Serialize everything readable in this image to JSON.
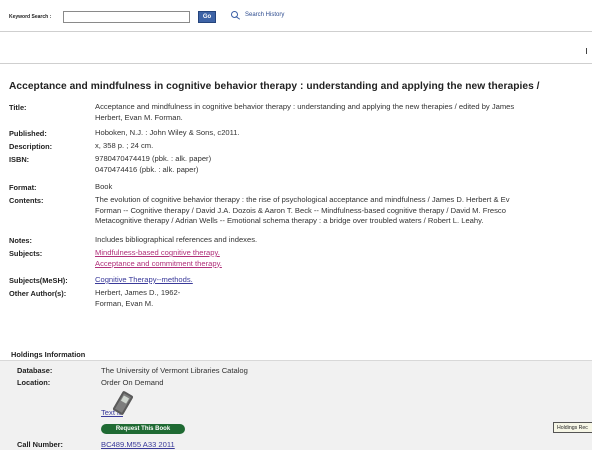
{
  "search": {
    "label": "Keyword Search :",
    "value": "",
    "go_label": "Go",
    "history_label": "Search History"
  },
  "record": {
    "title": "Acceptance and mindfulness in cognitive behavior therapy : understanding and applying the new therapies /",
    "fields": [
      {
        "label": "Title:",
        "lines": [
          "Acceptance and mindfulness in cognitive behavior therapy : understanding and applying the new therapies / edited by James",
          "Herbert, Evan M. Forman."
        ]
      },
      {
        "label": "Published:",
        "lines": [
          "Hoboken, N.J. : John Wiley & Sons, c2011."
        ]
      },
      {
        "label": "Description:",
        "lines": [
          "x, 358 p. ; 24 cm."
        ]
      },
      {
        "label": "ISBN:",
        "lines": [
          "9780470474419 (pbk. : alk. paper)",
          "0470474416 (pbk. : alk. paper)"
        ]
      },
      {
        "label": "Format:",
        "lines": [
          "Book"
        ]
      },
      {
        "label": "Contents:",
        "lines": [
          "The evolution of cognitive behavior therapy : the rise of psychological acceptance and mindfulness / James D. Herbert & Ev",
          "Forman -- Cognitive therapy / David J.A. Dozois & Aaron T. Beck -- Mindfulness-based cognitive therapy / David M. Fresco",
          "Metacognitive therapy / Adrian Wells -- Emotional schema therapy : a bridge over troubled waters / Robert L. Leahy."
        ]
      },
      {
        "label": "Notes:",
        "lines": [
          "Includes bibliographical references and indexes."
        ]
      },
      {
        "label": "Subjects:",
        "links": [
          "Mindfulness-based cognitive therapy.",
          "Acceptance and commitment therapy."
        ]
      },
      {
        "label": "Subjects(MeSH):",
        "links": [
          "Cognitive Therapy--methods."
        ]
      },
      {
        "label": "Other Author(s):",
        "lines": [
          "Herbert, James D., 1962-",
          "Forman, Evan M."
        ]
      }
    ]
  },
  "holdings": {
    "header": "Holdings Information",
    "database_label": "Database:",
    "database_value": "The University of Vermont Libraries Catalog",
    "location_label": "Location:",
    "location_value": "Order On Demand",
    "text_it": "Text it!",
    "request_button": "Request This Book",
    "call_number_label": "Call Number:",
    "call_number_value": "BC489.M55 A33 2011",
    "tooltip": "Holdings Rec"
  }
}
